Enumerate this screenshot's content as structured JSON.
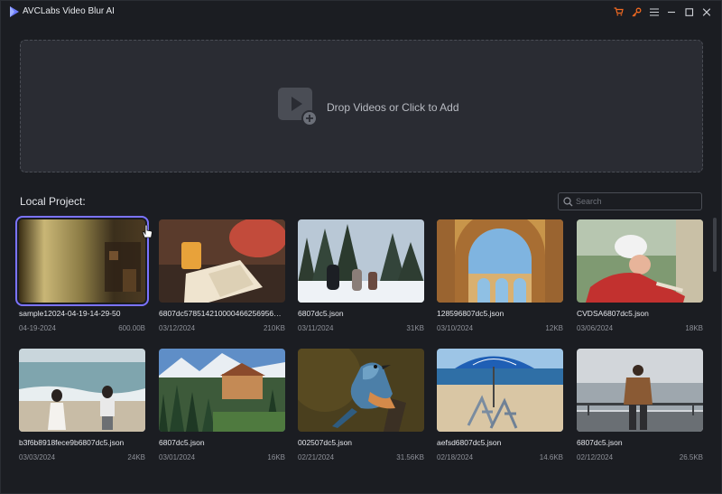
{
  "app": {
    "title": "AVCLabs Video Blur AI",
    "accent": "#7b73ff",
    "icon_color_orange": "#f26a21"
  },
  "titlebar": {
    "icons": [
      "cart-icon",
      "key-icon",
      "menu-icon",
      "minimize-icon",
      "maximize-icon",
      "close-icon"
    ]
  },
  "dropzone": {
    "label": "Drop Videos or Click to Add",
    "icon": "add-video-icon"
  },
  "section": {
    "title": "Local Project:"
  },
  "search": {
    "placeholder": "Search",
    "value": ""
  },
  "files": [
    {
      "name": "sample12024-04-19-14-29-50",
      "date": "04-19-2024",
      "size": "600.00B",
      "selected": true
    },
    {
      "name": "6807dc5785142100004662569562…",
      "date": "03/12/2024",
      "size": "210KB"
    },
    {
      "name": "6807dc5.json",
      "date": "03/11/2024",
      "size": "31KB"
    },
    {
      "name": "128596807dc5.json",
      "date": "03/10/2024",
      "size": "12KB"
    },
    {
      "name": "CVDSA6807dc5.json",
      "date": "03/06/2024",
      "size": "18KB"
    },
    {
      "name": "b3f6b8918fece9b6807dc5.json",
      "date": "03/03/2024",
      "size": "24KB"
    },
    {
      "name": "6807dc5.json",
      "date": "03/01/2024",
      "size": "16KB"
    },
    {
      "name": "002507dc5.json",
      "date": "02/21/2024",
      "size": "31.56KB"
    },
    {
      "name": "aefsd6807dc5.json",
      "date": "02/18/2024",
      "size": "14.6KB"
    },
    {
      "name": "6807dc5.json",
      "date": "02/12/2024",
      "size": "26.5KB"
    }
  ]
}
